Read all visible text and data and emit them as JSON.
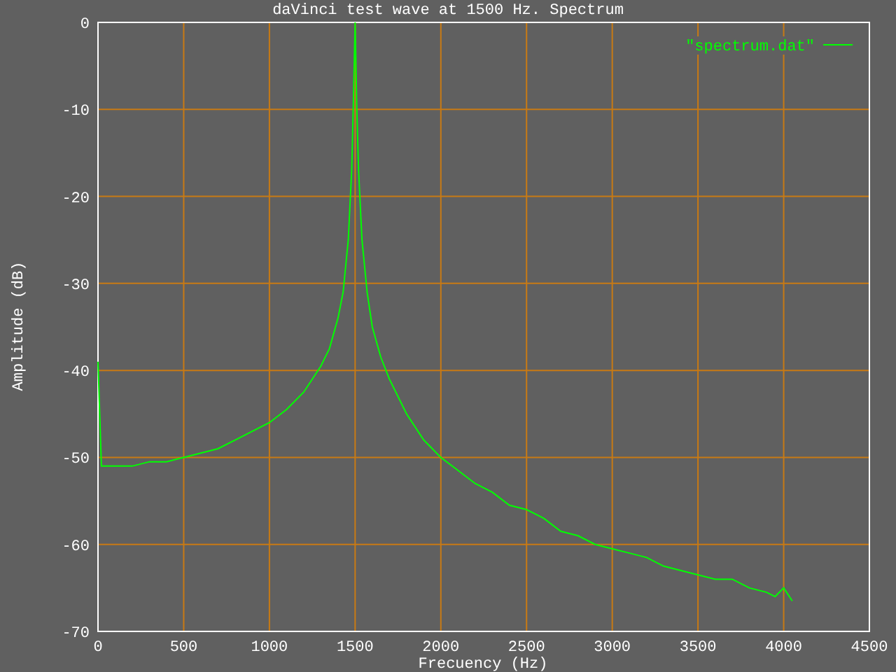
{
  "chart_data": {
    "type": "line",
    "title": "daVinci test wave at 1500 Hz. Spectrum",
    "xlabel": "Frecuency (Hz)",
    "ylabel": "Amplitude (dB)",
    "grid": true,
    "xlim": [
      0,
      4500
    ],
    "ylim": [
      -70,
      0
    ],
    "xticks": [
      0,
      500,
      1000,
      1500,
      2000,
      2500,
      3000,
      3500,
      4000,
      4500
    ],
    "yticks": [
      -70,
      -60,
      -50,
      -40,
      -30,
      -20,
      -10,
      0
    ],
    "x": [
      0,
      20,
      100,
      200,
      300,
      400,
      500,
      600,
      700,
      800,
      900,
      1000,
      1100,
      1200,
      1300,
      1350,
      1400,
      1430,
      1460,
      1480,
      1490,
      1500,
      1510,
      1520,
      1540,
      1570,
      1600,
      1650,
      1700,
      1800,
      1900,
      2000,
      2100,
      2200,
      2300,
      2400,
      2500,
      2600,
      2700,
      2800,
      2900,
      3000,
      3100,
      3200,
      3300,
      3400,
      3500,
      3600,
      3700,
      3800,
      3900,
      3950,
      4000,
      4050
    ],
    "series": [
      {
        "name": "\"spectrum.dat\"",
        "color": "#00ff00",
        "values": [
          -39,
          -51,
          -51,
          -51,
          -50.5,
          -50.5,
          -50,
          -49.5,
          -49,
          -48,
          -47,
          -46,
          -44.5,
          -42.5,
          -39.5,
          -37.5,
          -34,
          -31,
          -25,
          -17,
          -9,
          0,
          -10,
          -17,
          -25,
          -31,
          -35,
          -38.5,
          -41,
          -45,
          -48,
          -50,
          -51.5,
          -53,
          -54,
          -55.5,
          -56,
          -57,
          -58.5,
          -59,
          -60,
          -60.5,
          -61,
          -61.5,
          -62.5,
          -63,
          -63.5,
          -64,
          -64,
          -65,
          -65.5,
          -66,
          -65,
          -66.5
        ]
      }
    ]
  }
}
